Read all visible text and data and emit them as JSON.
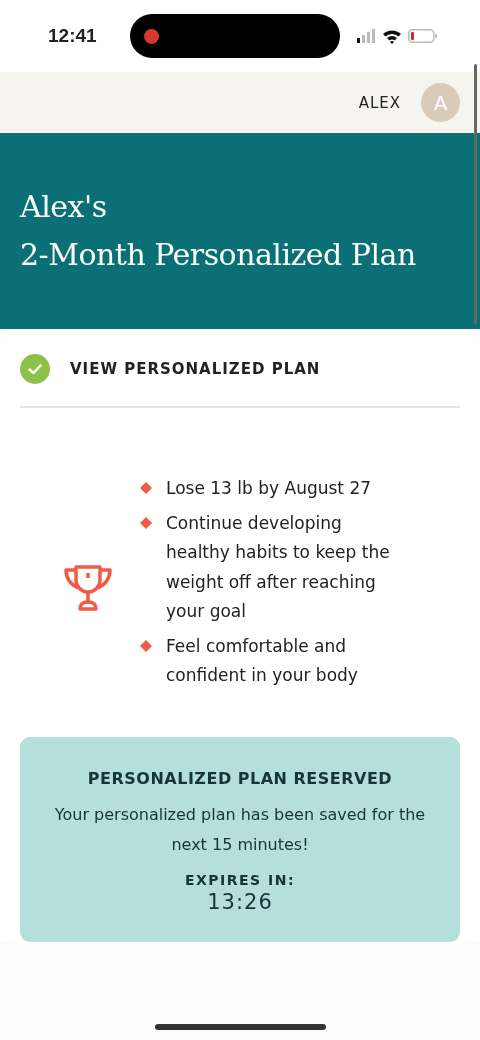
{
  "status_bar": {
    "time": "12:41"
  },
  "header": {
    "user_name": "ALEX",
    "avatar_initial": "A"
  },
  "hero": {
    "title_lines": [
      "Alex's",
      "2-Month Personalized Plan"
    ]
  },
  "step": {
    "label": "VIEW PERSONALIZED PLAN",
    "completed": true
  },
  "goals": [
    "Lose 13 lb by August 27",
    "Continue developing healthy habits to keep the weight off after reaching your goal",
    "Feel comfortable and confident in your body"
  ],
  "reservation": {
    "title": "PERSONALIZED PLAN RESERVED",
    "message": "Your personalized plan has been saved for the next 15 minutes!",
    "expires_label": "EXPIRES IN:",
    "countdown": "13:26"
  }
}
